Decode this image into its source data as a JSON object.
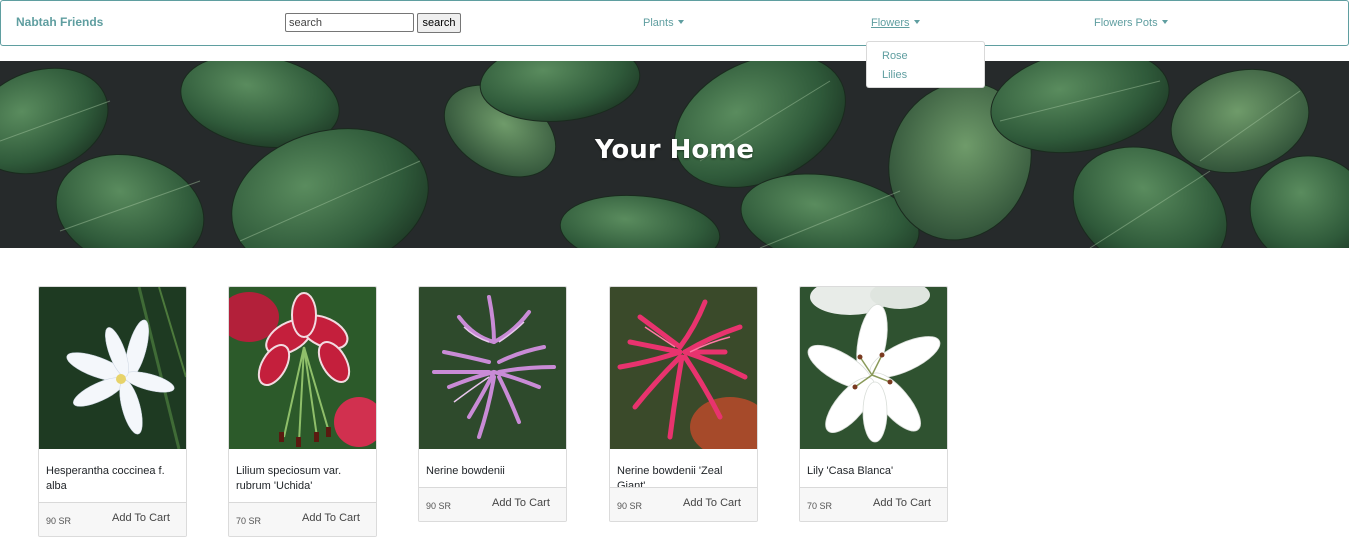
{
  "navbar": {
    "brand": "Nabtah Friends",
    "search": {
      "placeholder": "search",
      "button_label": "search"
    },
    "menu": [
      {
        "label": "Plants"
      },
      {
        "label": "Flowers"
      },
      {
        "label": "Flowers Pots"
      }
    ],
    "dropdown": {
      "items": [
        "Rose",
        "Lilies"
      ]
    }
  },
  "hero": {
    "title": "Your Home"
  },
  "products": [
    {
      "name": "Hesperantha coccinea f. alba",
      "price": "90 SR",
      "button": "Add To Cart"
    },
    {
      "name": "Lilium speciosum var. rubrum 'Uchida'",
      "price": "70 SR",
      "button": "Add To Cart"
    },
    {
      "name": "Nerine bowdenii",
      "price": "90 SR",
      "button": "Add To Cart"
    },
    {
      "name": "Nerine bowdenii 'Zeal Giant'",
      "price": "90 SR",
      "button": "Add To Cart"
    },
    {
      "name": "Lily 'Casa Blanca'",
      "price": "70 SR",
      "button": "Add To Cart"
    }
  ],
  "colors": {
    "accent": "#5f9ea0",
    "hero_bg": "#24282a",
    "leaf": "#3e6b47"
  }
}
